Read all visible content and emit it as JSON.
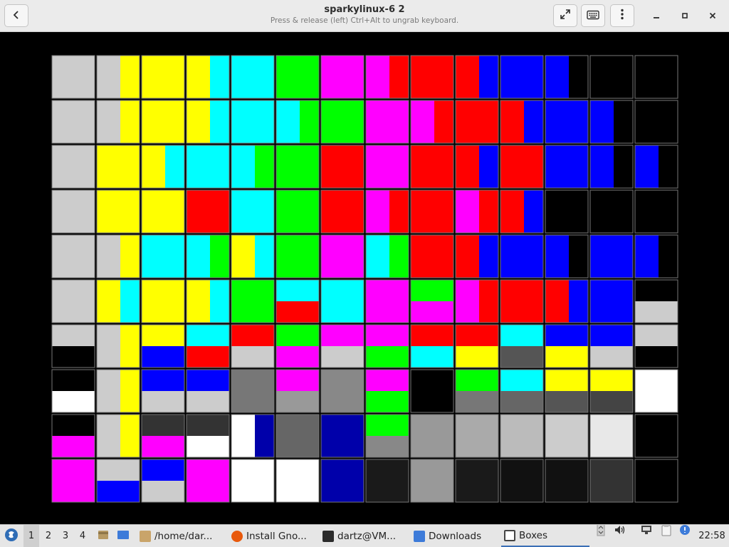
{
  "window": {
    "title": "sparkylinux-6 2",
    "subtitle": "Press & release (left) Ctrl+Alt to ungrab keyboard."
  },
  "icons": {
    "back": "back-arrow-icon",
    "fullscreen": "fullscreen-icon",
    "keyboard": "keyboard-icon",
    "menu": "kebab-menu-icon",
    "minimize": "minimize-icon",
    "maximize": "maximize-icon",
    "close": "close-icon"
  },
  "display": {
    "content": "test-pattern-color-grid",
    "rows": 10,
    "cols": 14,
    "cells": [
      [
        "#cccccc",
        "#cccccc|#ffff00",
        "#ffff00",
        "#ffff00|#00ffff",
        "#00ffff",
        "#00ff00",
        "#ff00ff",
        "#ff00ff|#ff0000",
        "#ff0000",
        "#ff0000|#0000ff",
        "#0000ff",
        "#0000ff|#000000",
        "#000000",
        "#000000"
      ],
      [
        "#cccccc",
        "#cccccc|#ffff00",
        "#ffff00",
        "#ffff00|#00ffff",
        "#00ffff",
        "#00ffff|#00ff00",
        "#00ff00",
        "#ff00ff",
        "#ff00ff|#ff0000",
        "#ff0000",
        "#ff0000|#0000ff",
        "#0000ff",
        "#0000ff|#000000",
        "#000000"
      ],
      [
        "#cccccc",
        "#ffff00",
        "#ffff00|#00ffff",
        "#00ffff",
        "#00ffff|#00ff00",
        "#00ff00",
        "#ff0000",
        "#ff00ff",
        "#ff0000",
        "#ff0000|#0000ff",
        "#ff0000",
        "#0000ff",
        "#0000ff|#000000",
        "#0000ff|#000000"
      ],
      [
        "#cccccc",
        "#ffff00",
        "#ffff00",
        "#ff0000",
        "#00ffff",
        "#00ff00",
        "#ff0000",
        "#ff00ff|#ff0000",
        "#ff0000",
        "#ff00ff|#ff0000",
        "#ff0000|#0000ff",
        "#000000",
        "#000000",
        "#000000"
      ],
      [
        "#cccccc",
        "#cccccc|#ffff00",
        "#00ffff",
        "#00ffff|#00ff00",
        "#ffff00|#00ffff",
        "#00ff00",
        "#ff00ff",
        "#00ffff|#00ff00",
        "#ff0000",
        "#ff0000|#0000ff",
        "#0000ff",
        "#0000ff|#000000",
        "#0000ff",
        "#0000ff|#000000"
      ],
      [
        "#cccccc",
        "#ffff00|#00ffff",
        "#ffff00",
        "#ffff00|#00ffff",
        "#00ff00",
        "#00ffff/#ff0000",
        "#00ffff",
        "#ff00ff",
        "#00ff00/#ff00ff",
        "#ff00ff|#ff0000",
        "#ff0000",
        "#ff0000|#0000ff",
        "#0000ff",
        "#000000/#cccccc"
      ],
      [
        "#cccccc/#000000",
        "#cccccc|#ffff00",
        "#ffff00/#0000ff",
        "#00ffff/#ff0000",
        "#ff0000/#cccccc",
        "#00ff00/#ff00ff",
        "#ff00ff/#cccccc",
        "#ff00ff/#00ff00",
        "#ff0000/#00ffff",
        "#ff0000/#ffff00",
        "#00ffff/#555555",
        "#0000ff/#ffff00",
        "#0000ff/#cccccc",
        "#cccccc/#000000"
      ],
      [
        "#000000/#ffffff",
        "#cccccc|#ffff00",
        "#0000ff/#cccccc",
        "#0000ff/#cccccc",
        "#777777",
        "#ff00ff/#999999",
        "#888888",
        "#ff00ff/#00ff00",
        "#000000",
        "#00ff00/#777777",
        "#00ffff/#666666",
        "#ffff00/#555555",
        "#ffff00/#444444",
        "#ffffff"
      ],
      [
        "#000000/#ff00ff",
        "#cccccc|#ffff00",
        "#333333/#ff00ff",
        "#333333/#ffffff",
        "#ffffff|#0000aa",
        "#666666",
        "#0000aa",
        "#00ff00/#888888",
        "#999999",
        "#aaaaaa",
        "#bbbbbb",
        "#cccccc",
        "#e8e8e8",
        "#000000"
      ],
      [
        "#ff00ff",
        "#cccccc/#0000ff",
        "#0000ff/#cccccc",
        "#ff00ff",
        "#ffffff",
        "#ffffff",
        "#0000aa",
        "#1a1a1a",
        "#999999",
        "#1a1a1a",
        "#111111",
        "#111111",
        "#333333",
        "#000000"
      ]
    ]
  },
  "taskbar": {
    "workspaces": [
      "1",
      "2",
      "3",
      "4"
    ],
    "active_workspace": "1",
    "tasks": [
      {
        "label": "/home/dar...",
        "icon": "folder-icon",
        "color": "#c9a46a"
      },
      {
        "label": "Install Gno...",
        "icon": "firefox-icon",
        "color": "#e8590c"
      },
      {
        "label": "dartz@VM...",
        "icon": "terminal-icon",
        "color": "#2b2b2b"
      },
      {
        "label": "Downloads",
        "icon": "folder-icon",
        "color": "#3d7bd9"
      },
      {
        "label": "Boxes",
        "icon": "boxes-icon",
        "color": "#444444"
      }
    ],
    "active_task": "Boxes",
    "clock": "22:58"
  }
}
